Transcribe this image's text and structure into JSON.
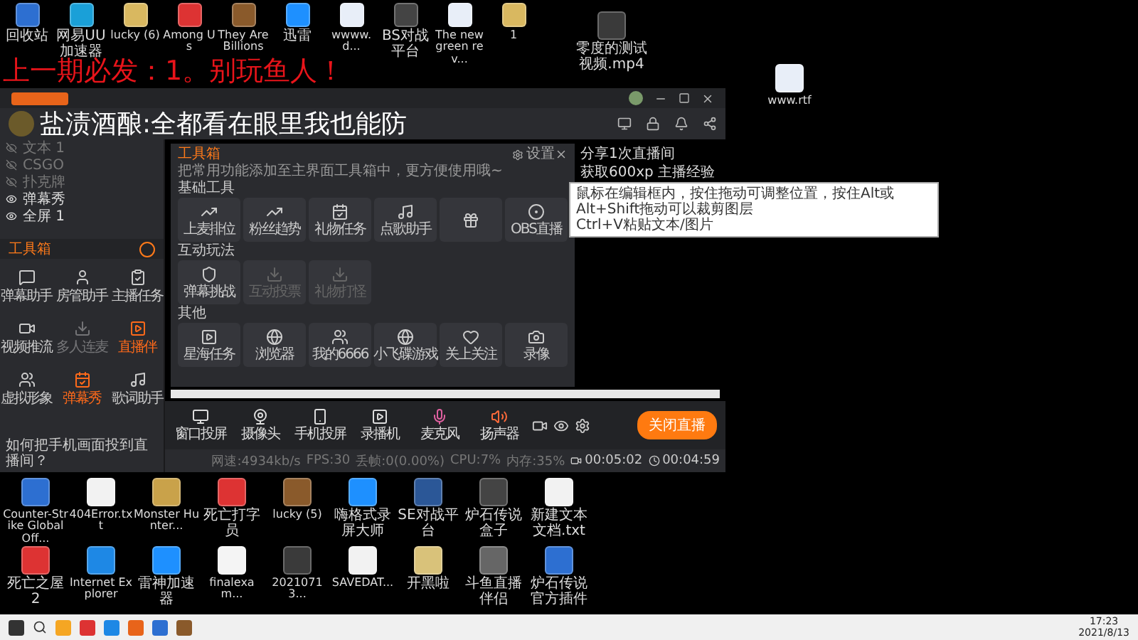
{
  "desktop_icons_top": [
    {
      "label": "回收站",
      "kind": "app"
    },
    {
      "label": "网易UU加速器",
      "kind": "app"
    },
    {
      "label": "lucky (6)",
      "kind": "folder"
    },
    {
      "label": "Among Us",
      "kind": "app"
    },
    {
      "label": "They Are Billions",
      "kind": "app"
    },
    {
      "label": "迅雷",
      "kind": "app"
    },
    {
      "label": "wwww.d...",
      "kind": "document"
    },
    {
      "label": "BS对战平台",
      "kind": "app"
    },
    {
      "label": "The new green rev...",
      "kind": "document"
    },
    {
      "label": "1",
      "kind": "folder"
    }
  ],
  "desktop_icons_right": [
    {
      "label": "零度的测试视频.mp4",
      "kind": "video"
    },
    {
      "label": "www.rtf",
      "kind": "document"
    }
  ],
  "overlay_caption": "上一期必发：1。别玩鱼人！",
  "app": {
    "header": {
      "title": "盐渍酒酿:全都看在眼里我也能防"
    },
    "scenes": [
      {
        "label": "文本 1",
        "visible": false
      },
      {
        "label": "CSGO",
        "visible": false
      },
      {
        "label": "扑克牌",
        "visible": false
      },
      {
        "label": "弹幕秀",
        "visible": true
      },
      {
        "label": "全屏 1",
        "visible": true
      }
    ],
    "toolbox": {
      "title": "工具箱",
      "tools": [
        {
          "label": "弹幕助手",
          "active": false,
          "disabled": false
        },
        {
          "label": "房管助手",
          "active": false,
          "disabled": false
        },
        {
          "label": "主播任务",
          "active": false,
          "disabled": false
        },
        {
          "label": "视频推流",
          "active": false,
          "disabled": false
        },
        {
          "label": "多人连麦",
          "active": false,
          "disabled": true
        },
        {
          "label": "直播伴",
          "active": true,
          "disabled": false
        },
        {
          "label": "虚拟形象",
          "active": false,
          "disabled": false
        },
        {
          "label": "弹幕秀",
          "active": true,
          "disabled": false
        },
        {
          "label": "歌词助手",
          "active": false,
          "disabled": false
        }
      ]
    },
    "panel": {
      "title": "工具箱",
      "description": "把常用功能添加至主界面工具箱中，更方便使用哦~",
      "settings_label": "设置",
      "sections": [
        {
          "title": "基础工具",
          "tools": [
            {
              "label": "上麦排位",
              "disabled": false
            },
            {
              "label": "粉丝趋势",
              "disabled": false
            },
            {
              "label": "礼物任务",
              "disabled": false
            },
            {
              "label": "点歌助手",
              "disabled": false
            },
            {
              "disabled": false
            },
            {
              "label": "OBS直播",
              "disabled": false
            }
          ]
        },
        {
          "title": "互动玩法",
          "tools": [
            {
              "label": "弹幕挑战",
              "disabled": false
            },
            {
              "label": "互动投票",
              "disabled": true
            },
            {
              "label": "礼物打怪",
              "disabled": true
            }
          ]
        },
        {
          "title": "其他",
          "tools": [
            {
              "label": "星海任务",
              "disabled": false
            },
            {
              "label": "浏览器",
              "disabled": false
            },
            {
              "label": "我的6666",
              "disabled": false
            },
            {
              "label": "小飞碟游戏",
              "disabled": false
            },
            {
              "label": "关上关注",
              "disabled": false
            },
            {
              "label": "录像",
              "disabled": false
            }
          ]
        }
      ]
    },
    "side_lines": [
      "分享1次直播间",
      "获取600xp 主播经验"
    ],
    "tooltip": [
      "鼠标在编辑框内，按住拖动可调整位置，按住Alt或Alt+Shift拖动可以裁剪图层",
      "Ctrl+V粘贴文本/图片"
    ],
    "controls": [
      {
        "label": "窗口投屏",
        "kind": "screen"
      },
      {
        "label": "摄像头",
        "kind": "camera"
      },
      {
        "label": "手机投屏",
        "kind": "phone"
      },
      {
        "label": "录播机",
        "kind": "recorder"
      },
      {
        "label": "麦克风",
        "kind": "mic"
      },
      {
        "label": "扬声器",
        "kind": "speaker"
      }
    ],
    "live_button": "关闭直播",
    "help_text": "如何把手机画面投到直播间？",
    "status": [
      "网速:4934kb/s",
      "FPS:30",
      "丢帧:0(0.00%)",
      "CPU:7%",
      "内存:35%"
    ],
    "timers": [
      {
        "kind": "recording",
        "text": "00:05:02"
      },
      {
        "kind": "live",
        "text": "00:04:59"
      }
    ]
  },
  "desktop_icons_bottom": [
    [
      {
        "label": "Counter-Strike Global Off...",
        "kind": "app"
      },
      {
        "label": "404Error.txt",
        "kind": "text"
      },
      {
        "label": "Monster Hunter...",
        "kind": "app"
      },
      {
        "label": "死亡打字员",
        "kind": "app"
      },
      {
        "label": "lucky (5)",
        "kind": "app"
      },
      {
        "label": "嗨格式录屏大师",
        "kind": "app"
      },
      {
        "label": "SE对战平台",
        "kind": "app"
      },
      {
        "label": "炉石传说盒子",
        "kind": "app"
      },
      {
        "label": "新建文本文档.txt",
        "kind": "text"
      }
    ],
    [
      {
        "label": "死亡之屋2",
        "kind": "app"
      },
      {
        "label": "Internet Explorer",
        "kind": "browser"
      },
      {
        "label": "雷神加速器",
        "kind": "app"
      },
      {
        "label": "finalexam...",
        "kind": "pdf"
      },
      {
        "label": "20210713...",
        "kind": "video"
      },
      {
        "label": "SAVEDAT...",
        "kind": "text"
      },
      {
        "label": "开黑啦",
        "kind": "app"
      },
      {
        "label": "斗鱼直播伴侣",
        "kind": "app"
      },
      {
        "label": "炉石传说官方插件",
        "kind": "app"
      }
    ]
  ],
  "taskbar": {
    "time": "17:23",
    "date": "2021/8/13"
  }
}
